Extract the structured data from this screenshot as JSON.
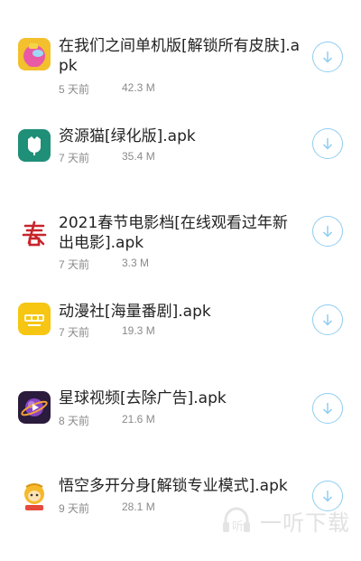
{
  "apps": [
    {
      "title": "在我们之间单机版[解锁所有皮肤].apk",
      "time": "5 天前",
      "size": "42.3 M",
      "icon": "among-us-icon",
      "icon_color": "#f3c02e"
    },
    {
      "title": "资源猫[绿化版].apk",
      "time": "7 天前",
      "size": "35.4 M",
      "icon": "resource-cat-icon",
      "icon_color": "#1f8f78"
    },
    {
      "title": "2021春节电影档[在线观看过年新出电影].apk",
      "time": "7 天前",
      "size": "3.3 M",
      "icon": "spring-festival-icon",
      "icon_color": "#c8242b"
    },
    {
      "title": "动漫社[海量番剧].apk",
      "time": "7 天前",
      "size": "19.3 M",
      "icon": "anime-club-icon",
      "icon_color": "#f6c612"
    },
    {
      "title": "星球视频[去除广告].apk",
      "time": "8 天前",
      "size": "21.6 M",
      "icon": "planet-video-icon",
      "icon_color": "#2b1b3d"
    },
    {
      "title": "悟空多开分身[解锁专业模式].apk",
      "time": "9 天前",
      "size": "28.1 M",
      "icon": "wukong-icon",
      "icon_color": "#f5b92a"
    }
  ],
  "download_icon": "download-arrow-icon",
  "accent_color": "#8fcdf0",
  "watermark": {
    "text": "一听下载"
  }
}
